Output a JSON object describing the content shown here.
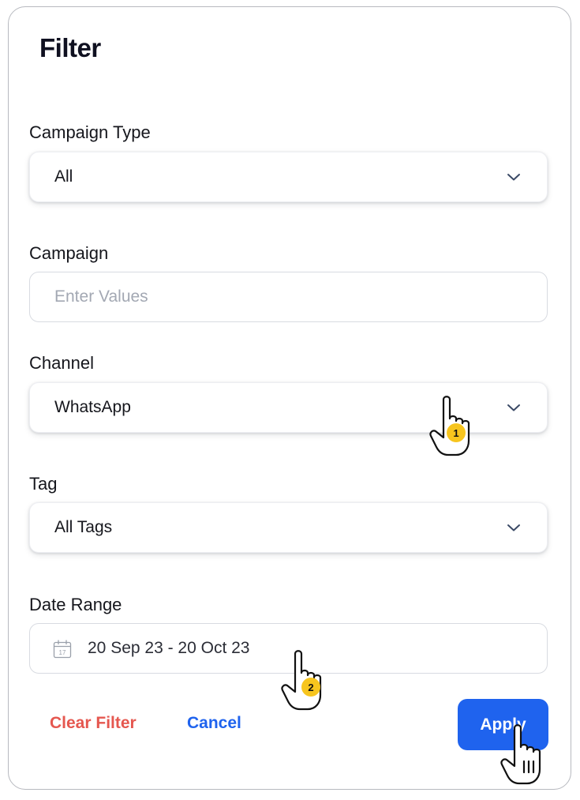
{
  "filter": {
    "title": "Filter",
    "campaign_type": {
      "label": "Campaign Type",
      "value": "All"
    },
    "campaign": {
      "label": "Campaign",
      "placeholder": "Enter Values"
    },
    "channel": {
      "label": "Channel",
      "value": "WhatsApp"
    },
    "tag": {
      "label": "Tag",
      "value": "All Tags"
    },
    "date_range": {
      "label": "Date Range",
      "value": "20 Sep 23 - 20 Oct 23"
    },
    "actions": {
      "clear_label": "Clear Filter",
      "cancel_label": "Cancel",
      "apply_label": "Apply"
    }
  },
  "annotations": {
    "step_1": "1",
    "step_2": "2"
  },
  "icons": {
    "dropdown": "chevron-down-icon",
    "date": "calendar-icon",
    "cursor": "hand-pointer-icon",
    "calendar_day": "17"
  },
  "colors": {
    "accent": "#1f63ee",
    "clear": "#e5574f",
    "badge": "#f7c51e"
  }
}
